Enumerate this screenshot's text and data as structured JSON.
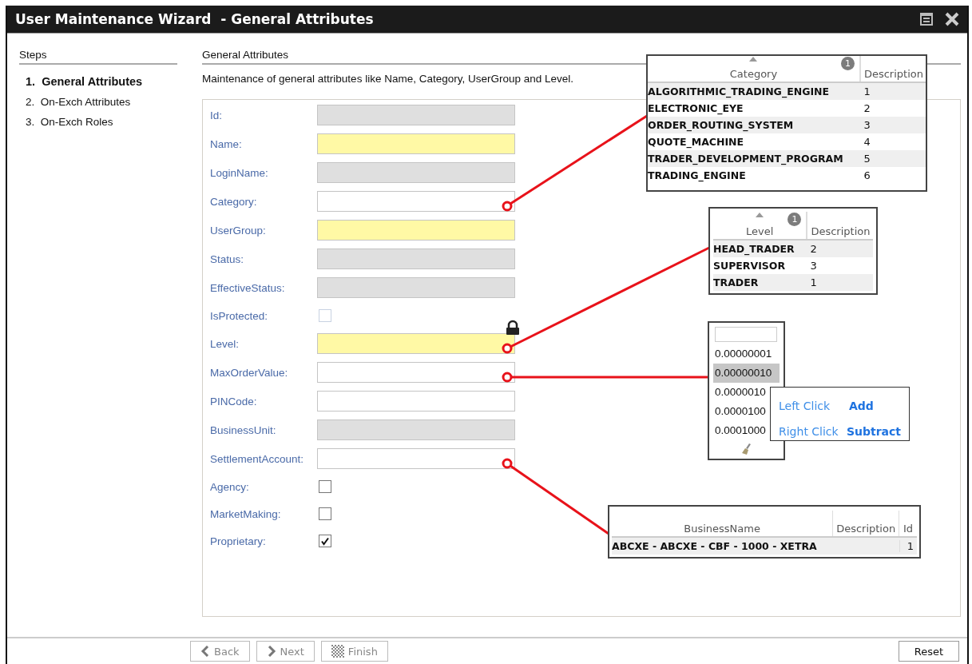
{
  "window": {
    "title": "User Maintenance Wizard  - General Attributes"
  },
  "steps": {
    "heading": "Steps",
    "items": [
      {
        "number": "1.",
        "label": "General Attributes",
        "selected": true
      },
      {
        "number": "2.",
        "label": "On-Exch Attributes",
        "selected": false
      },
      {
        "number": "3.",
        "label": "On-Exch Roles",
        "selected": false
      }
    ]
  },
  "page": {
    "heading": "General Attributes",
    "description": "Maintenance of general attributes like Name, Category, UserGroup and Level."
  },
  "fields": [
    {
      "label": "Id:",
      "kind": "readonly"
    },
    {
      "label": "Name:",
      "kind": "required"
    },
    {
      "label": "LoginName:",
      "kind": "readonly"
    },
    {
      "label": "Category:",
      "kind": "text"
    },
    {
      "label": "UserGroup:",
      "kind": "required"
    },
    {
      "label": "Status:",
      "kind": "readonly"
    },
    {
      "label": "EffectiveStatus:",
      "kind": "readonly"
    },
    {
      "label": "IsProtected:",
      "kind": "checkbox",
      "checked": false,
      "disabled": true
    },
    {
      "label": "Level:",
      "kind": "required"
    },
    {
      "label": "MaxOrderValue:",
      "kind": "text"
    },
    {
      "label": "PINCode:",
      "kind": "text"
    },
    {
      "label": "BusinessUnit:",
      "kind": "readonly"
    },
    {
      "label": "SettlementAccount:",
      "kind": "text"
    },
    {
      "label": "Agency:",
      "kind": "checkbox",
      "checked": false,
      "disabled": false
    },
    {
      "label": "MarketMaking:",
      "kind": "checkbox",
      "checked": false,
      "disabled": false
    },
    {
      "label": "Proprietary:",
      "kind": "checkbox",
      "checked": true,
      "disabled": false
    }
  ],
  "footer": {
    "buttons": [
      {
        "label": "Back",
        "kind": "back",
        "disabled": true
      },
      {
        "label": "Next",
        "kind": "next",
        "disabled": true
      },
      {
        "label": "Finish",
        "kind": "finish",
        "disabled": true
      }
    ],
    "reset": {
      "label": "Reset",
      "disabled": false
    }
  },
  "category_popup": {
    "columns": [
      "Category",
      "Description"
    ],
    "sort_badge": "1",
    "rows": [
      [
        "ALGORITHMIC_TRADING_ENGINE",
        "1"
      ],
      [
        "ELECTRONIC_EYE",
        "2"
      ],
      [
        "ORDER_ROUTING_SYSTEM",
        "3"
      ],
      [
        "QUOTE_MACHINE",
        "4"
      ],
      [
        "TRADER_DEVELOPMENT_PROGRAM",
        "5"
      ],
      [
        "TRADING_ENGINE",
        "6"
      ]
    ]
  },
  "level_popup": {
    "columns": [
      "Level",
      "Description"
    ],
    "sort_badge": "1",
    "rows": [
      [
        "HEAD_TRADER",
        "2"
      ],
      [
        "SUPERVISOR",
        "3"
      ],
      [
        "TRADER",
        "1"
      ]
    ]
  },
  "value_popup": {
    "rows": [
      {
        "value": "0.00000001",
        "selected": false
      },
      {
        "value": "0.00000010",
        "selected": true
      },
      {
        "value": "0.0000010",
        "selected": false
      },
      {
        "value": "0.0000100",
        "selected": false
      },
      {
        "value": "0.0001000",
        "selected": false
      }
    ]
  },
  "click_hint": {
    "rows": [
      {
        "action": "Left Click",
        "effect": "Add"
      },
      {
        "action": "Right Click",
        "effect": "Subtract"
      }
    ]
  },
  "business_popup": {
    "columns": [
      "BusinessName",
      "Description",
      "Id"
    ],
    "rows": [
      [
        "ABCXE - ABCXE - CBF - 1000 - XETRA",
        "",
        "1"
      ]
    ]
  }
}
